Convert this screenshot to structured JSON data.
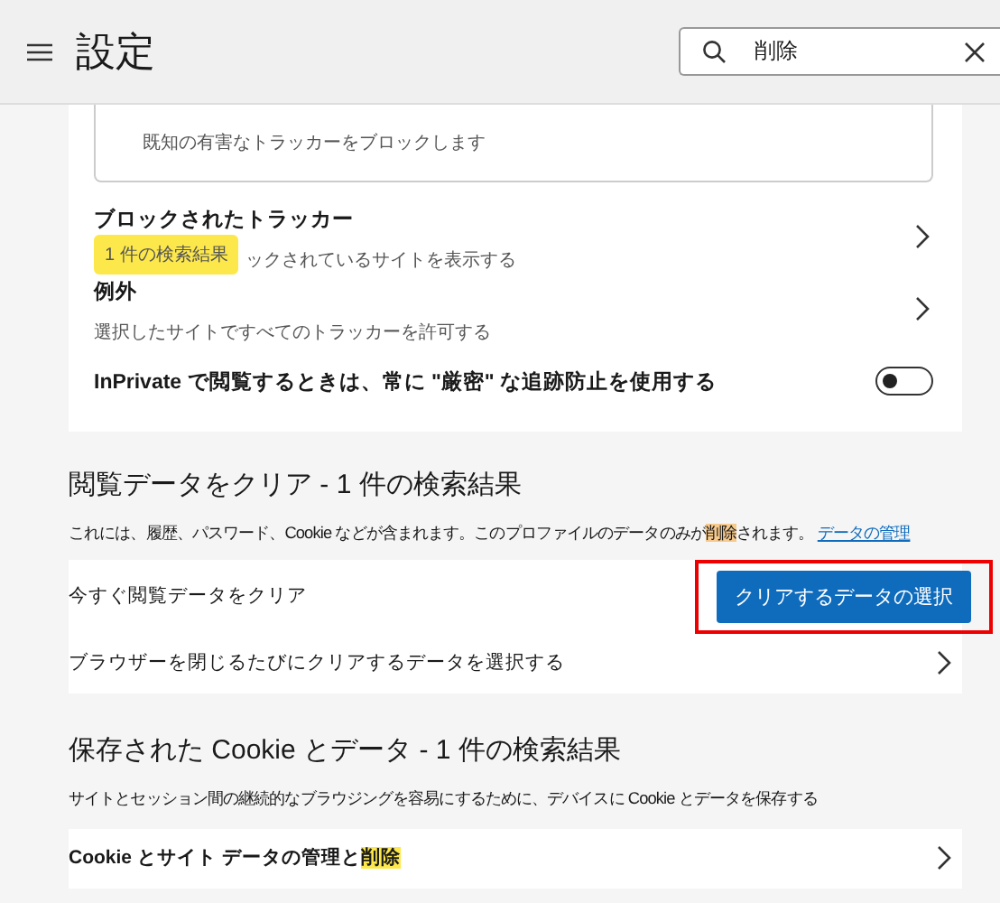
{
  "header": {
    "title": "設定",
    "search": {
      "value": "削除"
    }
  },
  "tracking": {
    "inner_text": "既知の有害なトラッカーをブロックします",
    "rows": [
      {
        "kind": "link",
        "title": "ブロックされたトラッカー",
        "subtitle": "ックされているサイトを表示する",
        "tooltip": "1 件の検索結果"
      },
      {
        "kind": "link",
        "title": "例外",
        "subtitle": "選択したサイトですべてのトラッカーを許可する"
      },
      {
        "kind": "toggle",
        "title": "InPrivate で閲覧するときは、常に \"厳密\" な追跡防止を使用する",
        "on": false
      }
    ]
  },
  "clear_section": {
    "title": "閲覧データをクリア - 1 件の検索結果",
    "description": [
      {
        "text": "これには、履歴、パスワード、Cookie などが含まれます。このプロファイルのデータのみが",
        "highlight": false
      },
      {
        "text": "削除",
        "highlight": true
      },
      {
        "text": "されます。",
        "highlight": false
      }
    ],
    "link": "データの管理",
    "rows": [
      {
        "kind": "button",
        "title": "今すぐ閲覧データをクリア",
        "button": "クリアするデータの選択"
      },
      {
        "kind": "link",
        "title": "ブラウザーを閉じるたびにクリアするデータを選択する"
      }
    ]
  },
  "cookie_section": {
    "title": "保存された Cookie とデータ - 1 件の検索結果",
    "description": "サイトとセッション間の継続的なブラウジングを容易にするために、デバイスに Cookie とデータを保存する",
    "rows": [
      {
        "title": [
          {
            "text": "Cookie とサイト データの管理と",
            "highlight": false
          },
          {
            "text": "削除",
            "highlight": true
          }
        ]
      }
    ]
  }
}
